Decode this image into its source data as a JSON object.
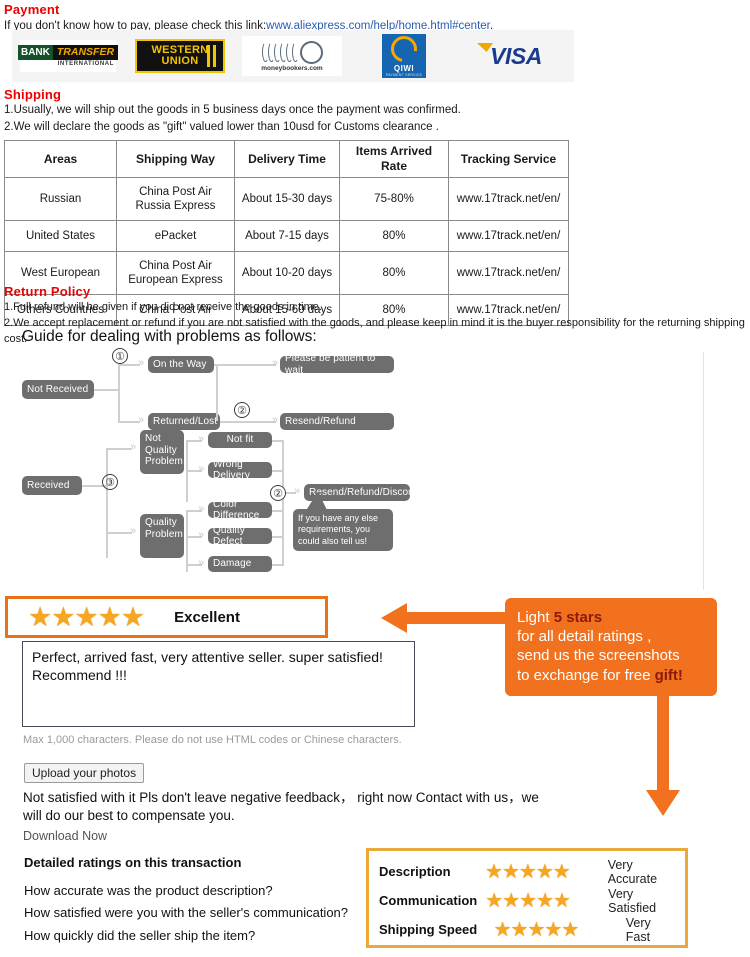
{
  "payment": {
    "title": "Payment",
    "note_prefix": "If you don't know how to pay, please check this link:",
    "note_link": "www.aliexpress.com/help/home.html#center",
    "note_suffix": ".",
    "logos": [
      {
        "name": "bank-transfer-international",
        "line1a": "BANK",
        "line1b": "TRANSFER",
        "line2": "INTERNATIONAL"
      },
      {
        "name": "western-union",
        "line1": "WESTERN",
        "line2": "UNION"
      },
      {
        "name": "moneybookers",
        "text": "moneybookers.com"
      },
      {
        "name": "qiwi",
        "text": "QIWI",
        "sub": "PAYMENT SERVICE"
      },
      {
        "name": "visa",
        "text": "VISA"
      }
    ]
  },
  "shipping": {
    "title": "Shipping",
    "line1": "1.Usually, we will ship out the goods in 5 business days once the payment was confirmed.",
    "line2": "2.We will declare the goods as \"gift\" valued lower than 10usd for Customs clearance .",
    "table": {
      "headers": [
        "Areas",
        "Shipping Way",
        "Delivery Time",
        "Items Arrived Rate",
        "Tracking Service"
      ],
      "rows": [
        {
          "areas": "Russian",
          "way": "China Post Air\nRussia Express",
          "time": "About 15-30 days",
          "rate": "75-80%",
          "tracking": "www.17track.net/en/"
        },
        {
          "areas": "United States",
          "way": "ePacket",
          "time": "About 7-15 days",
          "rate": "80%",
          "tracking": "www.17track.net/en/"
        },
        {
          "areas": "West European",
          "way": "China Post Air\nEuropean Express",
          "time": "About 10-20 days",
          "rate": "80%",
          "tracking": "www.17track.net/en/"
        },
        {
          "areas": "Others Countries",
          "way": "China Post Air",
          "time": "About 15-60 days",
          "rate": "80%",
          "tracking": "www.17track.net/en/"
        }
      ]
    }
  },
  "return_policy": {
    "title": "Return Policy",
    "line1": "1.Full refund will be given if you did not receive the goods in time.",
    "line2": "2.We accept replacement or refund if you are not satisfied with the goods, and please keep in mind it is the buyer responsibility for the returning shipping cost.",
    "guide_heading": "Guide for dealing with problems as follows:"
  },
  "flowchart": {
    "not_received": "Not Received",
    "on_the_way": "On the Way",
    "returned_lost": "Returned/Lost",
    "please_wait": "Please be patient to wait",
    "resend_refund": "Resend/Refund",
    "received": "Received",
    "not_quality_problem": "Not\nQuality\nProblem",
    "quality_problem": "Quality\nProblem",
    "not_fit": "Not fit",
    "wrong_delivery": "Wrong Delivery",
    "color_difference": "Color Difference",
    "quality_defect": "Quality Defect",
    "damage": "Damage",
    "resend_refund_discount": "Resend/Refund/Discount",
    "bubble": "If you have any else requirements, you could also tell us!",
    "markers": [
      "①",
      "②",
      "③",
      "②"
    ]
  },
  "feedback": {
    "excellent_label": "Excellent",
    "excellent_stars": 5,
    "star_glyph": "★",
    "review_text": "Perfect, arrived fast, very attentive seller. super satisfied!\nRecommend !!!",
    "hint": "Max 1,000 characters. Please do not use HTML codes or Chinese characters.",
    "upload_button": "Upload your photos",
    "not_satisfied": "Not satisfied with it Pls don't leave negative feedback，  right now Contact with us，we will do our best to compensate you.",
    "download_now": "Download Now",
    "detailed_heading": "Detailed ratings on this transaction",
    "questions": [
      "How accurate was the product description?",
      "How satisfied were you with the seller's communication?",
      "How quickly did the seller ship the item?"
    ]
  },
  "callout": {
    "line1_a": "Light ",
    "line1_b": "5 stars",
    "line2": "for all detail ratings ,",
    "line3": "send us the screenshots",
    "line4_a": "to exchange for free ",
    "line4_b": "gift!",
    "bg_color": "#f1711f",
    "highlight_color": "#8a1a0a"
  },
  "detailed_ratings": {
    "rows": [
      {
        "label": "Description",
        "stars": 5,
        "value": "Very Accurate"
      },
      {
        "label": "Communication",
        "stars": 5,
        "value": "Very Satisfied"
      },
      {
        "label": "Shipping Speed",
        "stars": 5,
        "value": "Very Fast"
      }
    ]
  },
  "colors": {
    "section_title": "#ec0000",
    "accent_orange": "#e8711a",
    "star_gold": "#f5a623",
    "flow_box": "#6e6e6e"
  }
}
